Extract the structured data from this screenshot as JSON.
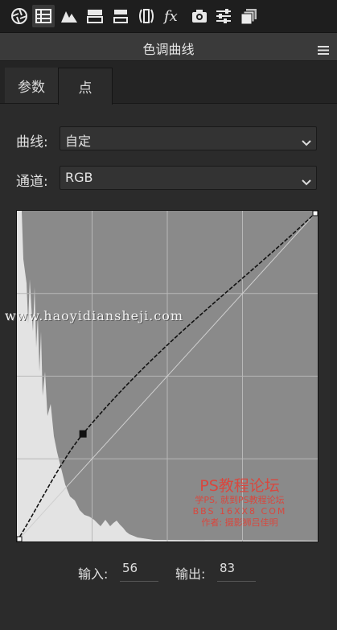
{
  "toolbar": {
    "icons": [
      "aperture-icon",
      "grid-table-icon",
      "mountains-icon",
      "split-toning-icon",
      "hsl-icon",
      "lens-icon",
      "fx-icon",
      "camera-icon",
      "sliders-icon",
      "presets-icon"
    ]
  },
  "panel": {
    "title": "色调曲线"
  },
  "tabs": [
    {
      "label": "参数"
    },
    {
      "label": "点"
    }
  ],
  "curve_field": {
    "label": "曲线:",
    "value": "自定"
  },
  "channel_field": {
    "label": "通道:",
    "value": "RGB"
  },
  "io": {
    "input_label": "输入:",
    "input_value": "56",
    "output_label": "输出:",
    "output_value": "83"
  },
  "watermark": {
    "url": "www.haoyidiansheji.com",
    "title": "PS教程论坛",
    "line1": "学PS, 就到PS教程论坛",
    "line2": "BBS 16XX8 COM",
    "line3": "作者: 摄影狮吕佳明"
  },
  "chart_data": {
    "type": "line",
    "xlim": [
      0,
      255
    ],
    "ylim": [
      0,
      255
    ],
    "grid": "4x4",
    "curve_points": [
      [
        0,
        0
      ],
      [
        56,
        83
      ],
      [
        255,
        255
      ]
    ],
    "colors": {
      "curve": "#111111",
      "baseline": "#cfcfcf",
      "plot_bg": "#8a8a8a",
      "histogram": "#e2e2e2"
    }
  }
}
